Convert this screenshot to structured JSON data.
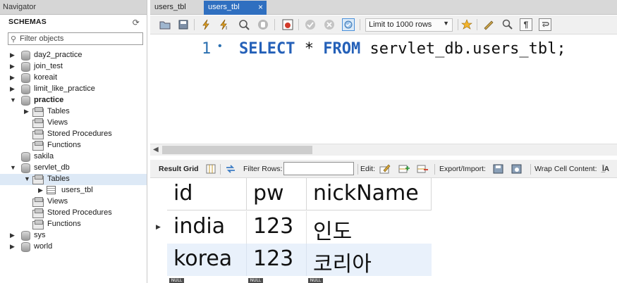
{
  "navigator": {
    "title": "Navigator",
    "schemas_label": "SCHEMAS",
    "filter_placeholder": "Filter objects",
    "tree": [
      {
        "label": "day2_practice",
        "icon": "database-icon",
        "expanded": false
      },
      {
        "label": "join_test",
        "icon": "database-icon",
        "expanded": false
      },
      {
        "label": "koreait",
        "icon": "database-icon",
        "expanded": false
      },
      {
        "label": "limit_like_practice",
        "icon": "database-icon",
        "expanded": false
      },
      {
        "label": "practice",
        "icon": "database-icon",
        "expanded": true,
        "bold": true
      },
      {
        "label": "Tables",
        "icon": "folder-icon",
        "expanded": false
      },
      {
        "label": "Views",
        "icon": "folder-icon"
      },
      {
        "label": "Stored Procedures",
        "icon": "folder-icon"
      },
      {
        "label": "Functions",
        "icon": "folder-icon"
      },
      {
        "label": "sakila",
        "icon": "database-icon"
      },
      {
        "label": "servlet_db",
        "icon": "database-icon",
        "expanded": true
      },
      {
        "label": "Tables",
        "icon": "folder-icon",
        "expanded": true,
        "selected": true
      },
      {
        "label": "users_tbl",
        "icon": "table-icon",
        "expanded": false
      },
      {
        "label": "Views",
        "icon": "folder-icon"
      },
      {
        "label": "Stored Procedures",
        "icon": "folder-icon"
      },
      {
        "label": "Functions",
        "icon": "folder-icon"
      },
      {
        "label": "sys",
        "icon": "database-icon",
        "expanded": false
      },
      {
        "label": "world",
        "icon": "database-icon",
        "expanded": false
      }
    ]
  },
  "tabs": [
    {
      "label": "users_tbl",
      "active": false
    },
    {
      "label": "users_tbl",
      "active": true,
      "close": "×"
    }
  ],
  "toolbar": {
    "limit_label": "Limit to 1000 rows",
    "icons": [
      "open-file-icon",
      "save-icon",
      "execute-icon",
      "execute-statement-icon",
      "explain-icon",
      "stop-icon",
      "toggle-error-icon",
      "commit-icon",
      "rollback-icon",
      "autocommit-icon",
      "bookmark-icon",
      "beautify-icon",
      "find-icon",
      "invisible-chars-icon",
      "wrap-icon"
    ]
  },
  "editor": {
    "line_number": "1",
    "keyword_select": "SELECT",
    "star": " * ",
    "keyword_from": "FROM",
    "target": " servlet_db.users_tbl;"
  },
  "result_toolbar": {
    "result_grid": "Result Grid",
    "filter_rows": "Filter Rows:",
    "edit": "Edit:",
    "export_import": "Export/Import:",
    "wrap_cell": "Wrap Cell Content:"
  },
  "grid": {
    "columns": [
      "id",
      "pw",
      "nickName"
    ],
    "rows": [
      [
        "india",
        "123",
        "인도"
      ],
      [
        "korea",
        "123",
        "코리아"
      ]
    ],
    "null_label": "NULL"
  },
  "colors": {
    "accent": "#2f6fc0",
    "keyword": "#2460b8",
    "selected_row": "#dde9f6"
  }
}
